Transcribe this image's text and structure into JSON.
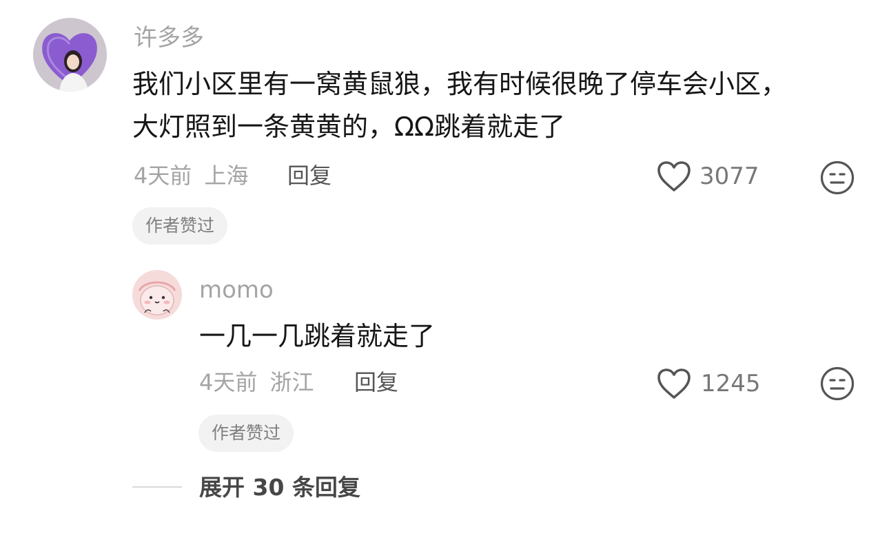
{
  "comment": {
    "username": "许多多",
    "text_line1": "我们小区里有一窝黄鼠狼，我有时候很晚了停车会小区，",
    "text_line2": "大灯照到一条黄黄的，ΩΩ跳着就走了",
    "time": "4天前",
    "location": "上海",
    "reply_label": "回复",
    "like_count": "3077",
    "badge": "作者赞过"
  },
  "reply": {
    "username": "momo",
    "text": "一几一几跳着就走了",
    "time": "4天前",
    "location": "浙江",
    "reply_label": "回复",
    "like_count": "1245",
    "badge": "作者赞过"
  },
  "expand": {
    "label": "展开 30 条回复"
  },
  "icons": {
    "like": "heart-outline-icon",
    "dislike": "meh-face-icon"
  },
  "colors": {
    "avatar_purple": "#8a5cd0",
    "avatar_pink": "#f6d7d7",
    "text_primary": "#161616",
    "text_secondary": "#a4a4a4"
  }
}
